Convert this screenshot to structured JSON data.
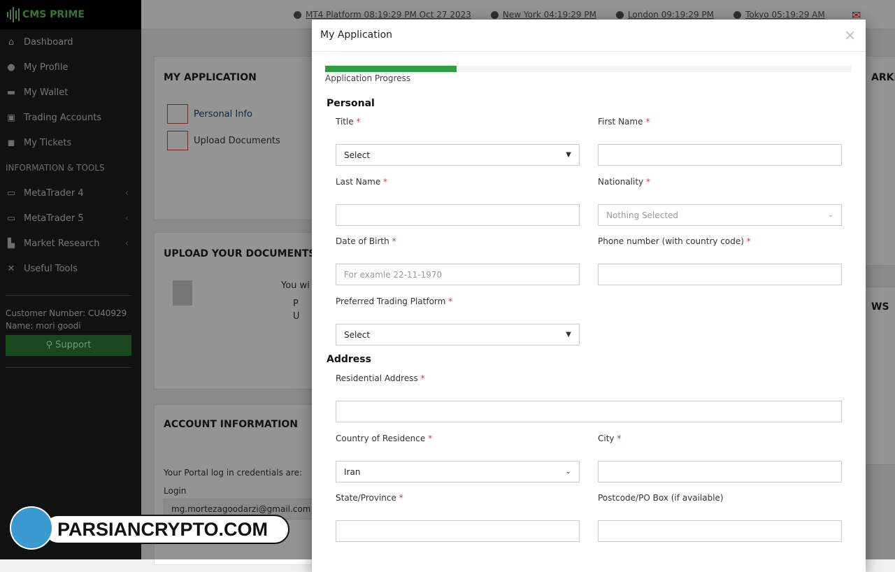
{
  "brand": {
    "logo": "CMS PRIME",
    "watermark": "PARSIANCRYPTO.COM"
  },
  "topbar": {
    "clocks": [
      "MT4 Platform  08:19:29 PM  Oct 27 2023",
      "New York  04:19:29 PM",
      "London  09:19:29 PM",
      "Tokyo  05:19:29 AM"
    ],
    "mail_icon": "envelope-icon"
  },
  "sidebar": {
    "items": [
      {
        "label": "Dashboard",
        "icon": "home-icon"
      },
      {
        "label": "My Profile",
        "icon": "user-icon"
      },
      {
        "label": "My Wallet",
        "icon": "folder-icon"
      },
      {
        "label": "Trading Accounts",
        "icon": "briefcase-icon"
      },
      {
        "label": "My Tickets",
        "icon": "comments-icon"
      }
    ],
    "section": "INFORMATION & TOOLS",
    "tools": [
      {
        "label": "MetaTrader 4",
        "icon": "laptop-icon"
      },
      {
        "label": "MetaTrader 5",
        "icon": "laptop-icon"
      },
      {
        "label": "Market Research",
        "icon": "chart-icon"
      },
      {
        "label": "Useful Tools",
        "icon": "tools-icon"
      }
    ],
    "customer_number": "Customer Number: CU40929",
    "name": "Name: mori goodi",
    "support": "Support"
  },
  "background": {
    "my_application": {
      "title": "MY APPLICATION",
      "items": [
        "Personal Info",
        "Upload Documents"
      ]
    },
    "upload": {
      "title": "UPLOAD YOUR DOCUMENTS",
      "text": "You wi",
      "bullets": [
        "P",
        "U"
      ]
    },
    "account": {
      "title": "ACCOUNT INFORMATION",
      "credentials": "Your Portal log in credentials are:",
      "login_label": "Login",
      "login_value": "mg.mortezagoodarzi@gmail.com"
    },
    "right_title": "ARKE",
    "news_title": "WS"
  },
  "modal": {
    "title": "My Application",
    "progress_label": "Application Progress",
    "progress_percent": 25,
    "personal": "Personal",
    "address": "Address",
    "fields": {
      "title": {
        "label": "Title",
        "value": "Select"
      },
      "first_name": {
        "label": "First Name",
        "value": ""
      },
      "last_name": {
        "label": "Last Name",
        "value": ""
      },
      "nationality": {
        "label": "Nationality",
        "value": "Nothing Selected"
      },
      "dob": {
        "label": "Date of Birth",
        "placeholder": "For examle 22-11-1970"
      },
      "phone": {
        "label": "Phone number (with country code)",
        "value": ""
      },
      "platform": {
        "label": "Preferred Trading Platform",
        "value": "Select"
      },
      "residential": {
        "label": "Residential Address",
        "value": ""
      },
      "country": {
        "label": "Country of Residence",
        "value": "Iran"
      },
      "city": {
        "label": "City",
        "value": ""
      },
      "state": {
        "label": "State/Province",
        "value": ""
      },
      "postcode": {
        "label": "Postcode/PO Box (if available)",
        "value": ""
      }
    }
  }
}
